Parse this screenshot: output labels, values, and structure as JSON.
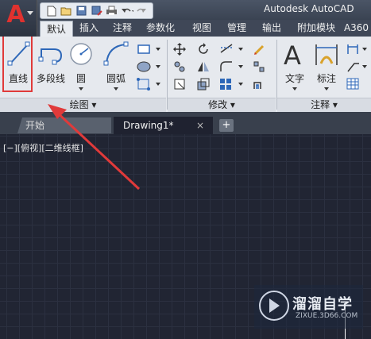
{
  "title_bar": {
    "app_title": "Autodesk AutoCAD",
    "app_letter": "A"
  },
  "quick_access": [
    "new-icon",
    "open-icon",
    "save-icon",
    "save-as-icon",
    "print-icon",
    "undo-icon",
    "redo-icon"
  ],
  "ribbon_tabs": [
    {
      "label": "默认",
      "active": true
    },
    {
      "label": "插入"
    },
    {
      "label": "注释"
    },
    {
      "label": "参数化"
    },
    {
      "label": "视图"
    },
    {
      "label": "管理"
    },
    {
      "label": "输出"
    },
    {
      "label": "附加模块"
    },
    {
      "label": "A360"
    }
  ],
  "panels": {
    "draw": {
      "title": "绘图",
      "tools": [
        {
          "label": "直线",
          "icon": "line-icon",
          "highlighted": true
        },
        {
          "label": "多段线",
          "icon": "polyline-icon"
        },
        {
          "label": "圆",
          "icon": "circle-icon"
        },
        {
          "label": "圆弧",
          "icon": "arc-icon"
        }
      ]
    },
    "modify": {
      "title": "修改"
    },
    "annotation": {
      "title": "注释",
      "tools": [
        {
          "label": "文字",
          "icon": "text-icon"
        },
        {
          "label": "标注",
          "icon": "dimension-icon"
        }
      ]
    }
  },
  "document_tabs": {
    "start": "开始",
    "drawing": "Drawing1*",
    "close_symbol": "×",
    "add_symbol": "+"
  },
  "viewport_label": "[−][俯视][二维线框]",
  "watermark": {
    "title": "溜溜自学",
    "url": "ZIXUE.3D66.COM"
  },
  "colors": {
    "highlight_red": "#e03a3a",
    "canvas_bg": "#212533",
    "ribbon_bg": "#e6e9ee"
  }
}
